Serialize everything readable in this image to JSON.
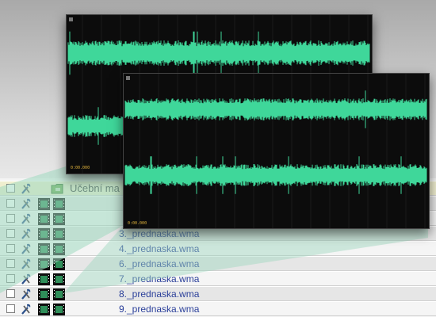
{
  "folder_row": {
    "label": "Učební ma",
    "icon": "folder-icon"
  },
  "files": [
    {
      "name": ""
    },
    {
      "name": ""
    },
    {
      "name": "3._prednaska.wma"
    },
    {
      "name": "4._prednaska.wma"
    },
    {
      "name": "6._prednaska.wma"
    },
    {
      "name": "7._prednaska.wma"
    },
    {
      "name": "8._prednaska.wma"
    },
    {
      "name": "9._prednaska.wma"
    }
  ],
  "colors": {
    "waveform": "#3fd79a",
    "window_bg": "#0c0c0c",
    "link": "#2a3f9a",
    "projection": "#9ed8bf"
  },
  "windows": {
    "back_timecode": "0:00.000",
    "front_timecode": "0:00.000"
  }
}
